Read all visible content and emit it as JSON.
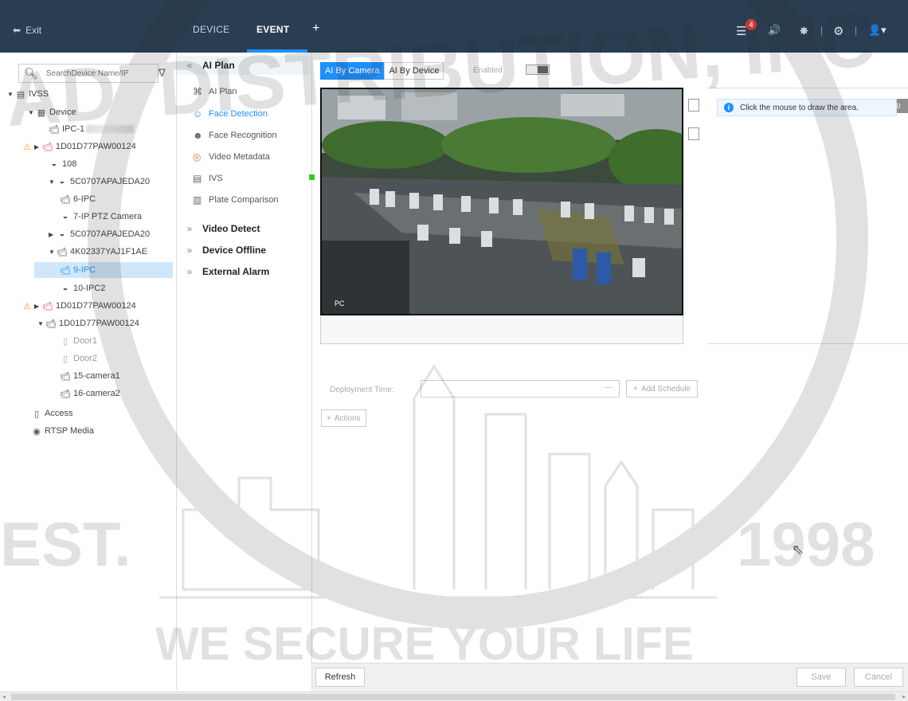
{
  "topbar": {
    "exit_label": "Exit",
    "tabs": {
      "device": "DEVICE",
      "event": "EVENT",
      "add": "+"
    },
    "notification_count": "4",
    "accent_color": "#1e8ffb",
    "bar_color": "#2a3e52"
  },
  "tree": {
    "search_placeholder": "SearchDevice Name/IP",
    "nodes": {
      "ivss": "IVSS",
      "device": "Device",
      "ipc1": "IPC-1",
      "n1d01_a": "1D01D77PAW00124",
      "n108": "108",
      "n5c_a": "5C0707APAJEDA20",
      "ipc6": "6-IPC",
      "ptz7": "7-IP PTZ Camera",
      "n5c_b": "5C0707APAJEDA20",
      "n4k": "4K02337YAJ1F1AE",
      "ipc9": "9-IPC",
      "ipc10": "10-IPC2",
      "n1d01_b": "1D01D77PAW00124",
      "n1d01_c": "1D01D77PAW00124",
      "door1": "Door1",
      "door2": "Door2",
      "cam15": "15-camera1",
      "cam16": "16-camera2",
      "access": "Access",
      "rtsp": "RTSP Media"
    }
  },
  "menu": {
    "ai_plan_group": "AI Plan",
    "items": {
      "ai_plan": "AI Plan",
      "face_detection": "Face Detection",
      "face_recognition": "Face Recognition",
      "video_metadata": "Video Metadata",
      "ivs": "IVS",
      "plate_comparison": "Plate Comparison"
    },
    "video_detect": "Video Detect",
    "device_offline": "Device Offline",
    "external_alarm": "External Alarm",
    "ivs_status_color": "#34c924"
  },
  "main": {
    "mode_tabs": {
      "by_camera": "AI By Camera",
      "by_device": "AI By Device"
    },
    "enabled_label": "Enabled",
    "alarm_chip": "290",
    "video_channel_label": "PC",
    "hint": "Click the mouse to draw the area.",
    "deployment_time_label": "Deployment Time:",
    "add_schedule": "Add Schedule",
    "actions": "Actions"
  },
  "footer": {
    "refresh": "Refresh",
    "save": "Save",
    "cancel": "Cancel"
  },
  "watermark": {
    "top_text": "ADI DISTRIBUTION, INC",
    "est": "EST.",
    "year": "1998",
    "tagline": "WE SECURE YOUR LIFE"
  }
}
